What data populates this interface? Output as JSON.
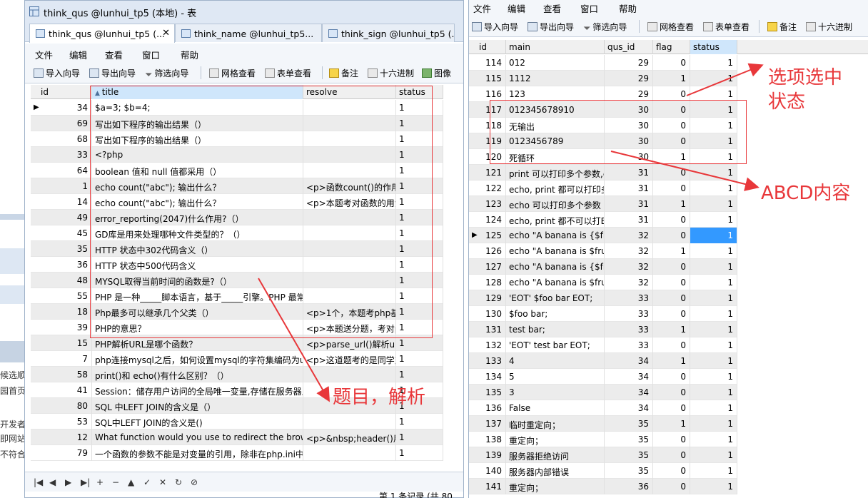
{
  "background": {
    "snippets": [
      "候选顺",
      "园首页",
      "开发者",
      "即网站",
      "不符合"
    ]
  },
  "left_window": {
    "title": "think_qus @lunhui_tp5 (本地) - 表",
    "tabs": [
      {
        "label": "think_qus @lunhui_tp5 (...",
        "closable": true
      },
      {
        "label": "think_name @lunhui_tp5..."
      },
      {
        "label": "think_sign @lunhui_tp5 (..."
      }
    ],
    "menu": [
      "文件",
      "编辑",
      "查看",
      "窗口",
      "帮助"
    ],
    "toolbar": [
      "导入向导",
      "导出向导",
      "筛选向导",
      "网格查看",
      "表单查看",
      "备注",
      "十六进制",
      "图像"
    ],
    "columns": [
      "id",
      "title",
      "resolve",
      "status"
    ],
    "rows": [
      {
        "id": "34",
        "title": "$a=3; $b=4;",
        "resolve": "",
        "status": "1"
      },
      {
        "id": "69",
        "title": "写出如下程序的输出结果（）",
        "resolve": "",
        "status": "1"
      },
      {
        "id": "68",
        "title": "写出如下程序的输出结果（）",
        "resolve": "",
        "status": "1"
      },
      {
        "id": "33",
        "title": "<?php",
        "resolve": "",
        "status": "1"
      },
      {
        "id": "64",
        "title": "boolean 值和 null 值都采用（）",
        "resolve": "",
        "status": "1"
      },
      {
        "id": "1",
        "title": "echo count(\"abc\"); 输出什么？",
        "resolve": "<p>函数count()的作用",
        "status": "1"
      },
      {
        "id": "14",
        "title": "echo count(\"abc\"); 输出什么？",
        "resolve": "<p>本题考对函数的用法",
        "status": "1"
      },
      {
        "id": "49",
        "title": "error_reporting(2047)什么作用?（）",
        "resolve": "",
        "status": "1"
      },
      {
        "id": "45",
        "title": "GD库是用来处理哪种文件类型的？（）",
        "resolve": "",
        "status": "1"
      },
      {
        "id": "35",
        "title": "HTTP 状态中302代码含义（）",
        "resolve": "",
        "status": "1"
      },
      {
        "id": "36",
        "title": "HTTP 状态中500代码含义",
        "resolve": "",
        "status": "1"
      },
      {
        "id": "48",
        "title": "MYSQL取得当前时间的函数是?（）",
        "resolve": "",
        "status": "1"
      },
      {
        "id": "55",
        "title": "PHP 是一种_____脚本语言，基于_____引擎。PHP 最常",
        "resolve": "",
        "status": "1"
      },
      {
        "id": "18",
        "title": "Php最多可以继承几个父类（）",
        "resolve": "<p>1个，本题考php基",
        "status": "1"
      },
      {
        "id": "39",
        "title": "PHP的意思？",
        "resolve": "<p>本题送分题，考对p",
        "status": "1"
      },
      {
        "id": "15",
        "title": "PHP解析URL是哪个函数？",
        "resolve": "<p>parse_url()解析url",
        "status": "1"
      },
      {
        "id": "7",
        "title": "php连接mysql之后，如何设置mysql的字符集编码为utf",
        "resolve": "<p>这道题考的是同学对",
        "status": "1"
      },
      {
        "id": "58",
        "title": "print()和 echo()有什么区别？（）",
        "resolve": "",
        "status": "1"
      },
      {
        "id": "41",
        "title": "Session：储存用户访问的全局唯一变量,存储在服务器上",
        "resolve": "",
        "status": "1"
      },
      {
        "id": "80",
        "title": "SQL 中LEFT JOIN的含义是（）",
        "resolve": "",
        "status": "1"
      },
      {
        "id": "53",
        "title": "SQL中LEFT JOIN的含义是()",
        "resolve": "",
        "status": "1"
      },
      {
        "id": "12",
        "title": "What function would you use to redirect the brow",
        "resolve": "<p>&nbsp;header()用",
        "status": "1"
      },
      {
        "id": "79",
        "title": "一个函数的参数不能是对变量的引用，除非在php.ini中",
        "resolve": "",
        "status": "1"
      }
    ],
    "nav_buttons": [
      "|◀",
      "◀",
      "▶",
      "▶|",
      "+",
      "−",
      "▲",
      "✓",
      "✕",
      "↻",
      "⊘"
    ],
    "status_text": "第 1 条记录 (共 80 条"
  },
  "right_window": {
    "menu": [
      "文件",
      "编辑",
      "查看",
      "窗口",
      "帮助"
    ],
    "toolbar": [
      "导入向导",
      "导出向导",
      "筛选向导",
      "网格查看",
      "表单查看",
      "备注",
      "十六进制"
    ],
    "columns": [
      "id",
      "main",
      "qus_id",
      "flag",
      "status"
    ],
    "rows": [
      {
        "id": "114",
        "main": "012",
        "qus_id": "29",
        "flag": "0",
        "status": "1"
      },
      {
        "id": "115",
        "main": "1112",
        "qus_id": "29",
        "flag": "1",
        "status": "1"
      },
      {
        "id": "116",
        "main": "123",
        "qus_id": "29",
        "flag": "0",
        "status": "1"
      },
      {
        "id": "117",
        "main": "012345678910",
        "qus_id": "30",
        "flag": "0",
        "status": "1"
      },
      {
        "id": "118",
        "main": "无输出",
        "qus_id": "30",
        "flag": "0",
        "status": "1"
      },
      {
        "id": "119",
        "main": "0123456789",
        "qus_id": "30",
        "flag": "0",
        "status": "1"
      },
      {
        "id": "120",
        "main": "死循环",
        "qus_id": "30",
        "flag": "1",
        "status": "1"
      },
      {
        "id": "121",
        "main": "print 可以打印多个参数,e",
        "qus_id": "31",
        "flag": "0",
        "status": "1"
      },
      {
        "id": "122",
        "main": "echo, print 都可以打印多",
        "qus_id": "31",
        "flag": "0",
        "status": "1"
      },
      {
        "id": "123",
        "main": " echo 可以打印多个参数",
        "qus_id": "31",
        "flag": "1",
        "status": "1"
      },
      {
        "id": "124",
        "main": "echo, print 都不可以打E",
        "qus_id": "31",
        "flag": "0",
        "status": "1"
      },
      {
        "id": "125",
        "main": " echo \"A banana is {$fru",
        "qus_id": "32",
        "flag": "0",
        "status": "1"
      },
      {
        "id": "126",
        "main": "echo \"A banana is $fru",
        "qus_id": "32",
        "flag": "1",
        "status": "1"
      },
      {
        "id": "127",
        "main": "echo \"A banana is {$fru",
        "qus_id": "32",
        "flag": "0",
        "status": "1"
      },
      {
        "id": "128",
        "main": "echo \"A banana is $fru",
        "qus_id": "32",
        "flag": "0",
        "status": "1"
      },
      {
        "id": "129",
        "main": " 'EOT' $foo bar EOT;",
        "qus_id": "33",
        "flag": "0",
        "status": "1"
      },
      {
        "id": "130",
        "main": " $foo bar;",
        "qus_id": "33",
        "flag": "0",
        "status": "1"
      },
      {
        "id": "131",
        "main": " test bar;",
        "qus_id": "33",
        "flag": "1",
        "status": "1"
      },
      {
        "id": "132",
        "main": "'EOT' test bar EOT;",
        "qus_id": "33",
        "flag": "0",
        "status": "1"
      },
      {
        "id": "133",
        "main": "4",
        "qus_id": "34",
        "flag": "1",
        "status": "1"
      },
      {
        "id": "134",
        "main": "5",
        "qus_id": "34",
        "flag": "0",
        "status": "1"
      },
      {
        "id": "135",
        "main": "3",
        "qus_id": "34",
        "flag": "0",
        "status": "1"
      },
      {
        "id": "136",
        "main": "False",
        "qus_id": "34",
        "flag": "0",
        "status": "1"
      },
      {
        "id": "137",
        "main": "临时重定向；",
        "qus_id": "35",
        "flag": "1",
        "status": "1"
      },
      {
        "id": "138",
        "main": "重定向；",
        "qus_id": "35",
        "flag": "0",
        "status": "1"
      },
      {
        "id": "139",
        "main": "服务器拒绝访问",
        "qus_id": "35",
        "flag": "0",
        "status": "1"
      },
      {
        "id": "140",
        "main": "服务器内部错误",
        "qus_id": "35",
        "flag": "0",
        "status": "1"
      },
      {
        "id": "141",
        "main": "重定向；",
        "qus_id": "36",
        "flag": "0",
        "status": "1"
      }
    ]
  },
  "annotations": {
    "status_note": "选项选中\n状态",
    "abcd_note": "ABCD内容",
    "title_note": "题目，解析"
  },
  "colors": {
    "annotation_red": "#e8373a",
    "selection_blue": "#3399ff",
    "window_chrome": "#dfe8f4"
  }
}
